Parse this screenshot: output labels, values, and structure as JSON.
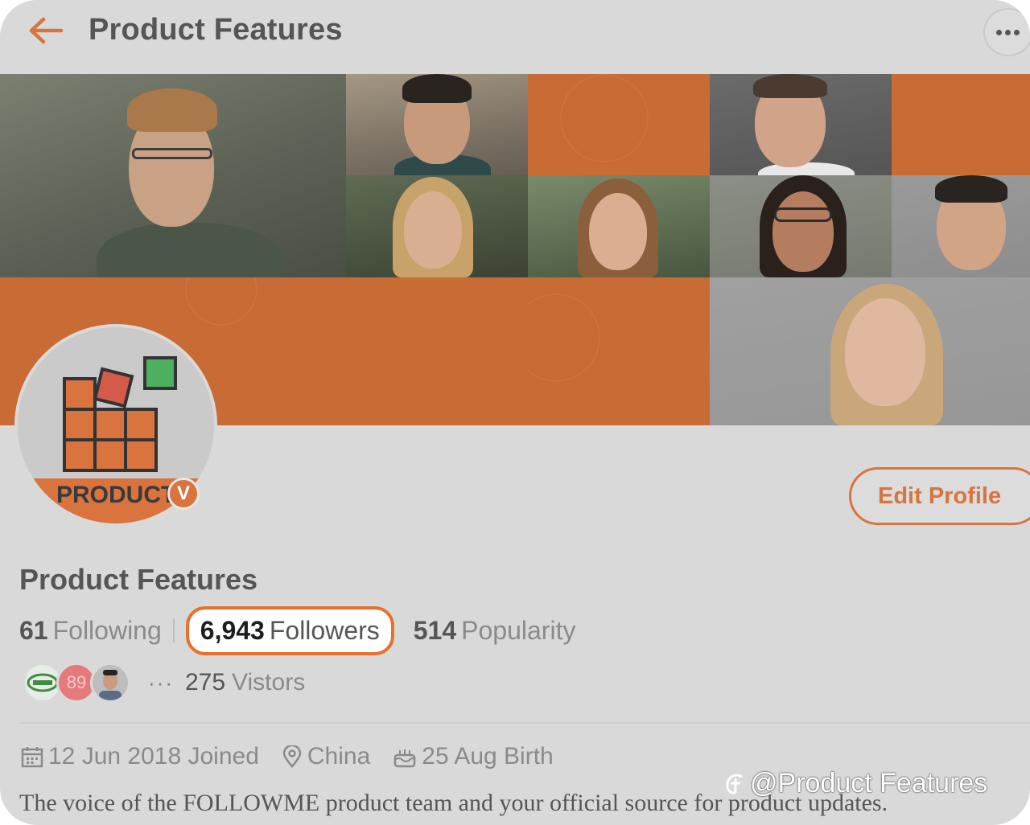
{
  "header": {
    "title": "Product Features",
    "back_icon": "back-arrow-icon",
    "more_icon": "more-horizontal-icon"
  },
  "colors": {
    "accent": "#e8702f",
    "banner_orange": "#c96b34",
    "page_bg": "#d9d9d9"
  },
  "avatar": {
    "logo_text": "PRODUCT",
    "verified_badge": "V"
  },
  "edit_profile_label": "Edit Profile",
  "profile": {
    "name": "Product Features",
    "stats": {
      "following": {
        "count": "61",
        "label": "Following"
      },
      "followers": {
        "count": "6,943",
        "label": "Followers"
      },
      "popularity": {
        "count": "514",
        "label": "Popularity"
      }
    },
    "visitors": {
      "badge_number": "89",
      "more": "···",
      "count": "275",
      "label": "Vistors"
    },
    "meta": {
      "joined": "12 Jun 2018 Joined",
      "location": "China",
      "birthday": "25 Aug Birth"
    },
    "bio": "The voice of the FOLLOWME product team and your official source for product updates."
  },
  "watermark": {
    "text": "@Product Features"
  }
}
